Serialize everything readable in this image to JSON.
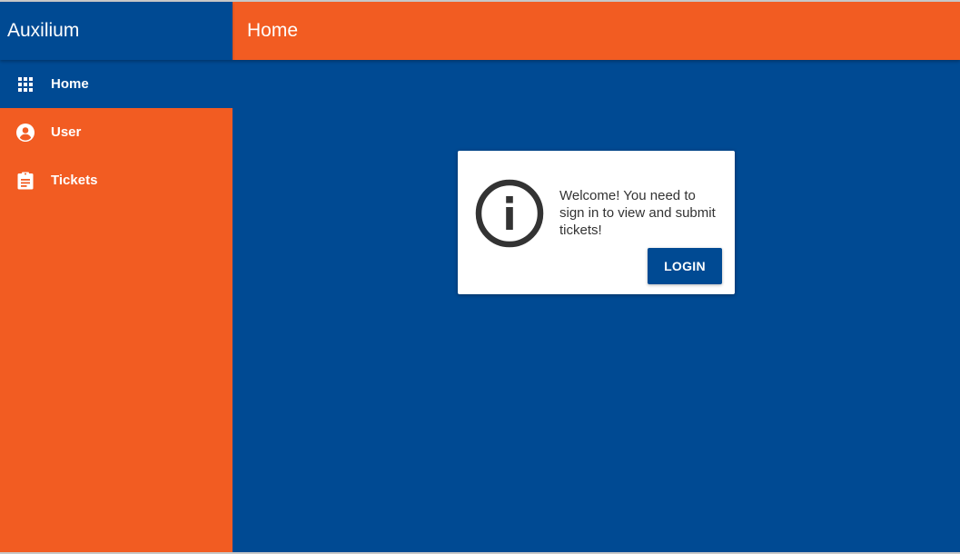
{
  "app": {
    "title": "Auxilium"
  },
  "sidebar": {
    "items": [
      {
        "label": "Home",
        "icon": "apps-grid-icon",
        "active": true
      },
      {
        "label": "User",
        "icon": "account-circle-icon",
        "active": false
      },
      {
        "label": "Tickets",
        "icon": "clipboard-icon",
        "active": false
      }
    ]
  },
  "header": {
    "title": "Home"
  },
  "card": {
    "icon": "info-icon",
    "message": "Welcome! You need to sign in to view and submit tickets!",
    "login_label": "LOGIN"
  },
  "colors": {
    "primary": "#004a93",
    "accent": "#f25c22",
    "card_bg": "#ffffff",
    "text": "#333333"
  }
}
